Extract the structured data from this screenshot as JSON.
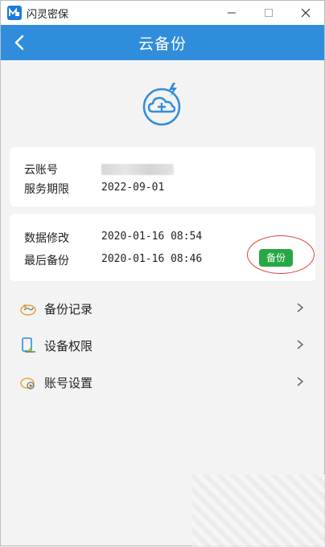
{
  "window": {
    "app_title": "闪灵密保"
  },
  "header": {
    "title": "云备份"
  },
  "account": {
    "label_account": "云账号",
    "label_service": "服务期限",
    "service_value": "2022-09-01"
  },
  "data": {
    "label_modified": "数据修改",
    "modified_value": "2020-01-16 08:54",
    "label_last_backup": "最后备份",
    "last_backup_value": "2020-01-16 08:46",
    "backup_button": "备份"
  },
  "menu": {
    "items": [
      {
        "label": "备份记录",
        "icon": "history-icon"
      },
      {
        "label": "设备权限",
        "icon": "device-permission-icon"
      },
      {
        "label": "账号设置",
        "icon": "account-settings-icon"
      }
    ]
  },
  "colors": {
    "header_blue": "#2f8ddb",
    "backup_green": "#27a844",
    "highlight_red": "#e0403c"
  }
}
